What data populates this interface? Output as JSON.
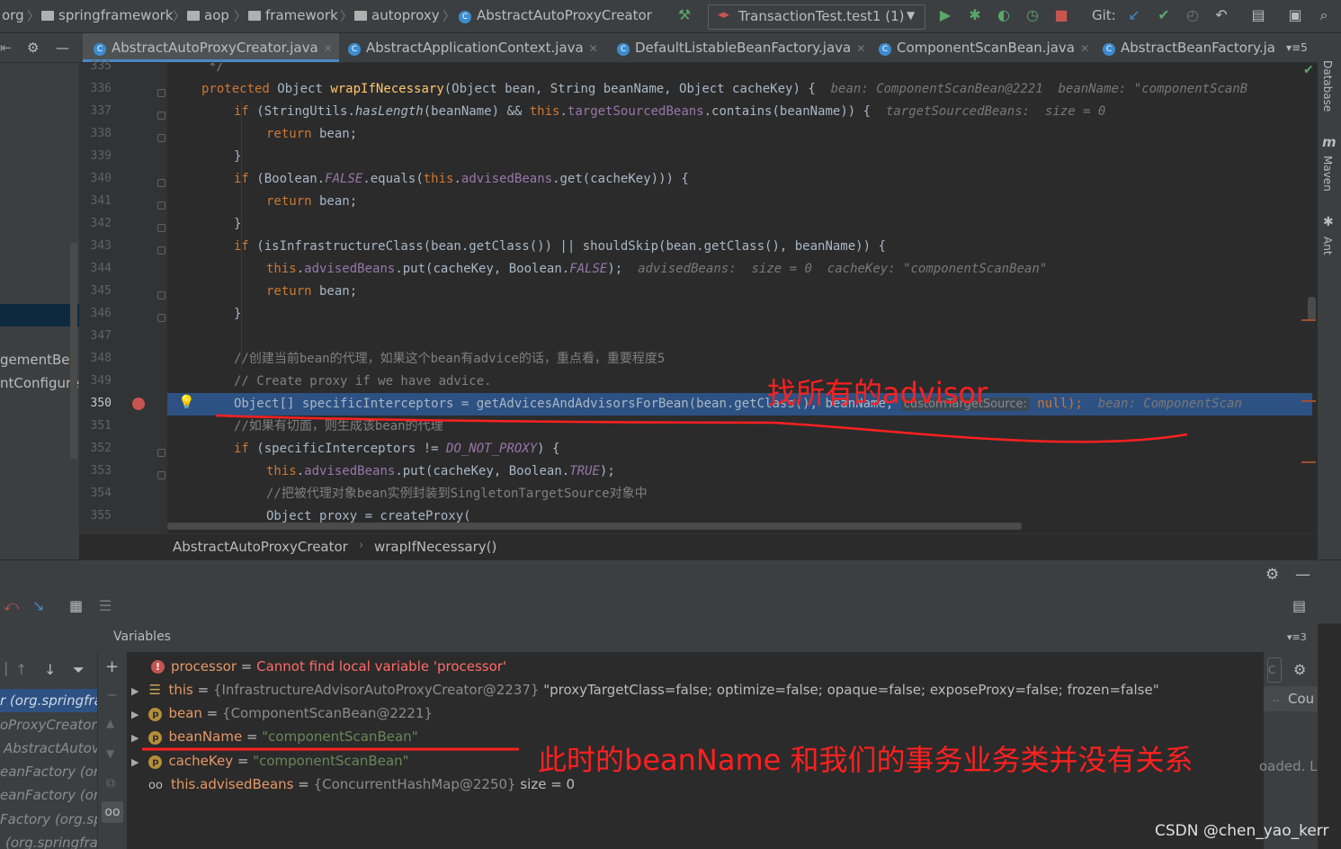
{
  "navbar": {
    "crumbs": [
      "org",
      "springframework",
      "aop",
      "framework",
      "autoproxy",
      "AbstractAutoProxyCreator"
    ],
    "run_config": "TransactionTest.test1 (1)",
    "git_label": "Git:"
  },
  "tabs": [
    {
      "label": "AbstractAutoProxyCreator.java",
      "active": true
    },
    {
      "label": "AbstractApplicationContext.java",
      "active": false
    },
    {
      "label": "DefaultListableBeanFactory.java",
      "active": false
    },
    {
      "label": "ComponentScanBean.java",
      "active": false
    },
    {
      "label": "AbstractBeanFactory.ja",
      "active": false
    }
  ],
  "tabs_overflow": "5",
  "editor": {
    "line_numbers": [
      "335",
      "336",
      "337",
      "338",
      "339",
      "340",
      "341",
      "342",
      "343",
      "344",
      "345",
      "346",
      "347",
      "348",
      "349",
      "350",
      "351",
      "352",
      "353",
      "354",
      "355"
    ],
    "current_line": "350",
    "code": {
      "l335": "*/",
      "l336": [
        "protected",
        "Object",
        "wrapIfNecessary",
        "(Object bean, String beanName, Object cacheKey) {",
        "bean: ComponentScanBean@2221",
        "beanName: \"componentScanB"
      ],
      "l337": [
        "if",
        "(StringUtils.",
        "hasLength",
        "(beanName) && ",
        "this",
        ".",
        "targetSourcedBeans",
        ".contains(beanName)) {",
        "targetSourcedBeans:  size = 0"
      ],
      "l338": [
        "return",
        " bean;"
      ],
      "l339": "}",
      "l340": [
        "if",
        " (Boolean.",
        "FALSE",
        ".equals(",
        "this",
        ".",
        "advisedBeans",
        ".get(cacheKey))) {"
      ],
      "l341": [
        "return",
        " bean;"
      ],
      "l342": "}",
      "l343": [
        "if",
        " (isInfrastructureClass(bean.getClass()) || shouldSkip(bean.getClass(), beanName)) {"
      ],
      "l344": [
        "this",
        ".",
        "advisedBeans",
        ".put(cacheKey, Boolean.",
        "FALSE",
        ");",
        "advisedBeans:  size = 0  cacheKey: \"componentScanBean\""
      ],
      "l345": [
        "return",
        " bean;"
      ],
      "l346": "}",
      "l348": "//创建当前bean的代理，如果这个bean有advice的话，重点看，重要程度5",
      "l349": "// Create proxy if we have advice.",
      "l350": [
        "Object[] specificInterceptors = getAdvicesAndAdvisorsForBean(bean.getClass(), beanName, ",
        "customTargetSource:",
        " null);",
        "bean: ComponentScan"
      ],
      "l351": "//如果有切面，则生成该bean的代理",
      "l352": [
        "if",
        " (specificInterceptors != ",
        "DO_NOT_PROXY",
        ") {"
      ],
      "l353": [
        "this",
        ".",
        "advisedBeans",
        ".put(cacheKey, Boolean.",
        "TRUE",
        ");"
      ],
      "l354": "//把被代理对象bean实例封装到SingletonTargetSource对象中",
      "l355": "Object proxy = createProxy("
    }
  },
  "right_tools": [
    "Database",
    "Maven",
    "Ant"
  ],
  "breadcrumb": {
    "class": "AbstractAutoProxyCreator",
    "method": "wrapIfNecessary()"
  },
  "frames": [
    "r (org.springfra",
    "oProxyCreator (o",
    "AbstractAutov",
    "eanFactory (org",
    "eanFactory (org",
    "Factory (org.sp",
    "(org.springfra"
  ],
  "variables_tab": "Variables",
  "watches": {
    "overflow": "3",
    "partial": "Cou",
    "loaded": "oaded. L"
  },
  "variables": [
    {
      "name": "processor",
      "eq": " = ",
      "value": "Cannot find local variable 'processor'",
      "kind": "error"
    },
    {
      "name": "this",
      "eq": " = ",
      "ref": "{InfrastructureAdvisorAutoProxyCreator@2237}",
      "value": " \"proxyTargetClass=false; optimize=false; opaque=false; exposeProxy=false; frozen=false\"",
      "kind": "field"
    },
    {
      "name": "bean",
      "eq": " = ",
      "ref": "{ComponentScanBean@2221}",
      "kind": "param"
    },
    {
      "name": "beanName",
      "eq": " = ",
      "value": "\"componentScanBean\"",
      "kind": "param"
    },
    {
      "name": "cacheKey",
      "eq": " = ",
      "value": "\"componentScanBean\"",
      "kind": "param"
    },
    {
      "name": "this.advisedBeans",
      "eq": " = ",
      "ref": "{ConcurrentHashMap@2250}",
      "value": "  size = 0",
      "kind": "watch"
    }
  ],
  "annotations": {
    "advisor": "找所有的advisor",
    "beanname": "此时的beanName 和我们的事务业务类并没有关系"
  },
  "watermark": "CSDN @chen_yao_kerr",
  "colors": {
    "annotation": "#ff2020",
    "selection": "#2d5182",
    "breakpoint": "#c75450"
  }
}
